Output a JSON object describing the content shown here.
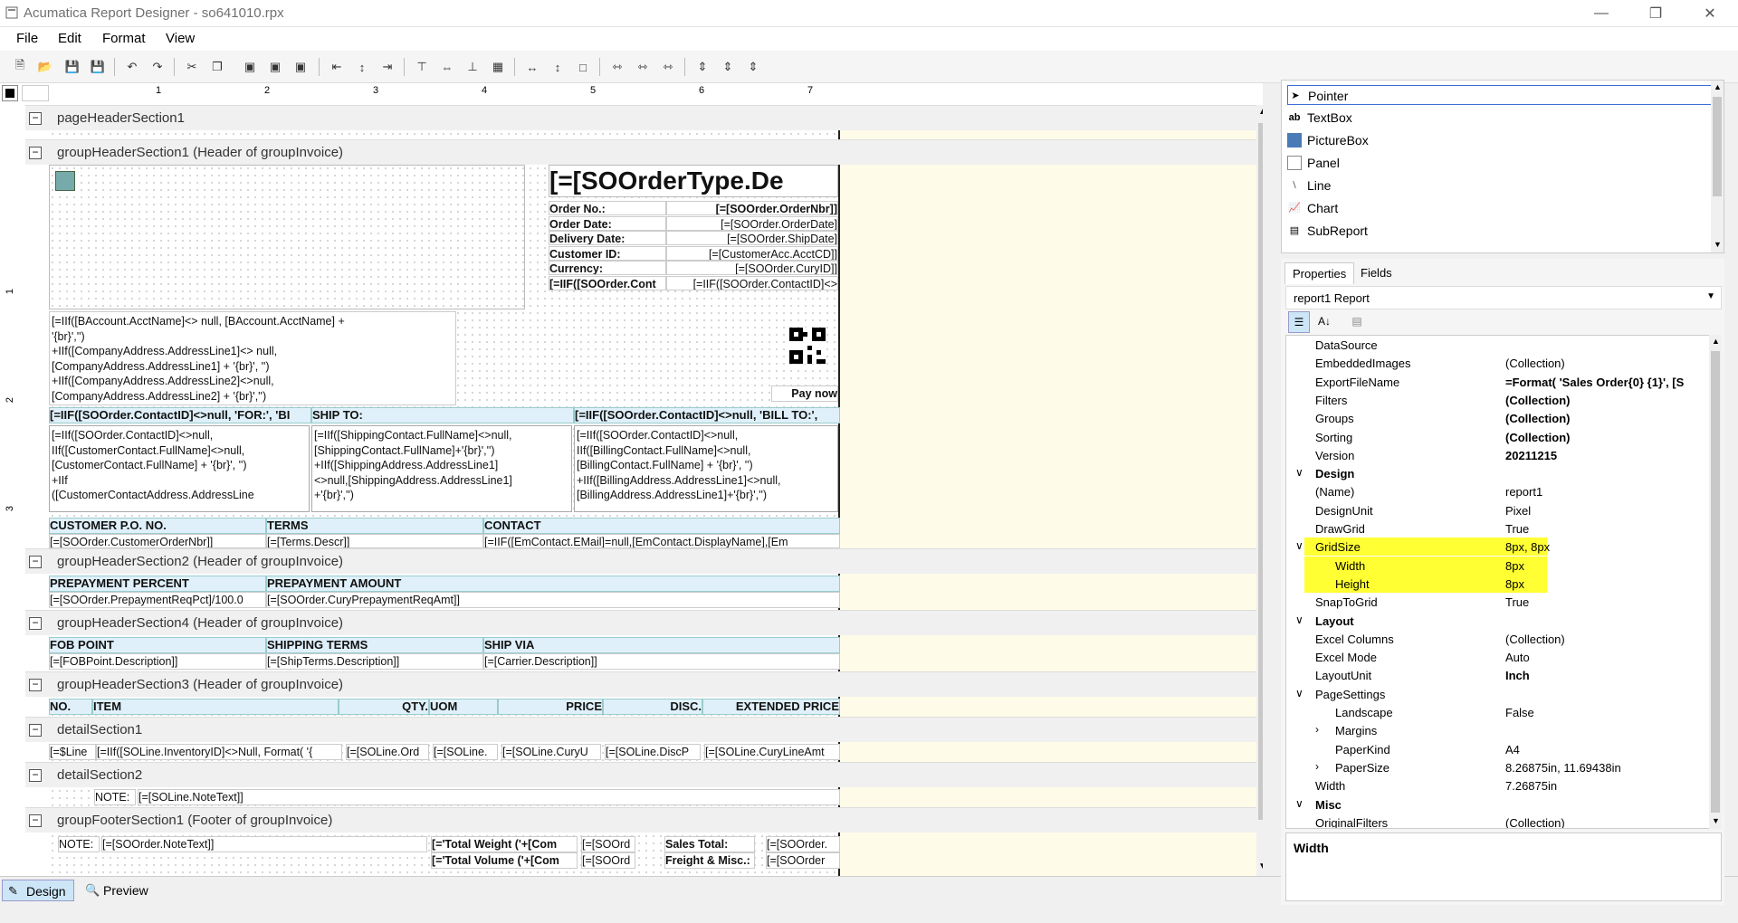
{
  "window": {
    "title": "Acumatica Report Designer - so641010.rpx"
  },
  "menu": [
    "File",
    "Edit",
    "Format",
    "View"
  ],
  "ruler": {
    "h": [
      "1",
      "2",
      "3",
      "4",
      "5",
      "6",
      "7"
    ],
    "v": [
      "1",
      "2",
      "3"
    ]
  },
  "sections": {
    "s1": "pageHeaderSection1",
    "s2": "groupHeaderSection1 (Header of groupInvoice)",
    "s3": "groupHeaderSection2 (Header of groupInvoice)",
    "s4": "groupHeaderSection4 (Header of groupInvoice)",
    "s5": "groupHeaderSection3 (Header of groupInvoice)",
    "s6": "detailSection1",
    "s7": "detailSection2",
    "s8": "groupFooterSection1 (Footer of groupInvoice)"
  },
  "header": {
    "title": "[=[SOOrderType.De",
    "fields": [
      [
        "Order No.:",
        "[=[SOOrder.OrderNbr]]"
      ],
      [
        "Order Date:",
        "[=[SOOrder.OrderDate]"
      ],
      [
        "Delivery Date:",
        "[=[SOOrder.ShipDate]"
      ],
      [
        "Customer ID:",
        "[=[CustomerAcc.AcctCD]]"
      ],
      [
        "Currency:",
        "[=[SOOrder.CuryID]]"
      ],
      [
        "[=IIF([SOOrder.Cont",
        "[=IIF([SOOrder.ContactID]<>"
      ]
    ],
    "company": [
      "[=IIf([BAccount.AcctName]<> null, [BAccount.AcctName] +",
      "'{br}','')",
      "+IIf([CompanyAddress.AddressLine1]<> null,",
      "[CompanyAddress.AddressLine1] + '{br}', '')",
      "+IIf([CompanyAddress.AddressLine2]<>null,",
      "[CompanyAddress.AddressLine2] + '{br}','')"
    ],
    "paynow": "Pay now",
    "cols": [
      "[=IIF([SOOrder.ContactID]<>null, 'FOR:', 'BI",
      "SHIP TO:",
      "[=IIF([SOOrder.ContactID]<>null, 'BILL TO:',"
    ],
    "col1": [
      "[=IIf([SOOrder.ContactID]<>null,",
      "IIf([CustomerContact.FullName]<>null,",
      "[CustomerContact.FullName] + '{br}', '')",
      "+IIf",
      "([CustomerContactAddress.AddressLine"
    ],
    "col2": [
      "[=IIf([ShippingContact.FullName]<>null,",
      "[ShippingContact.FullName]+'{br}','')",
      "+IIf([ShippingAddress.AddressLine1]",
      "<>null,[ShippingAddress.AddressLine1]",
      "+'{br}','')"
    ],
    "col3": [
      "[=IIf([SOOrder.ContactID]<>null,",
      "IIf([BillingContact.FullName]<>null,",
      "[BillingContact.FullName] + '{br}', '')",
      "+IIf([BillingAddress.AddressLine1]<>null,",
      "[BillingAddress.AddressLine1]+'{br}','')"
    ],
    "po": [
      "CUSTOMER P.O. NO.",
      "TERMS",
      "CONTACT"
    ],
    "poVals": [
      "[=[SOOrder.CustomerOrderNbr]]",
      "[=[Terms.Descr]]",
      "[=IIF([EmContact.EMail]=null,[EmContact.DisplayName],[Em"
    ]
  },
  "gh2": {
    "hdr": [
      "PREPAYMENT PERCENT",
      "PREPAYMENT AMOUNT"
    ],
    "vals": [
      "[=[SOOrder.PrepaymentReqPct]/100.0",
      "[=[SOOrder.CuryPrepaymentReqAmt]]"
    ]
  },
  "gh4": {
    "hdr": [
      "FOB POINT",
      "SHIPPING TERMS",
      "SHIP VIA"
    ],
    "vals": [
      "[=[FOBPoint.Description]]",
      "[=[ShipTerms.Description]]",
      "[=[Carrier.Description]]"
    ]
  },
  "gh3": {
    "hdr": [
      "NO.",
      "ITEM",
      "QTY.",
      "UOM",
      "PRICE",
      "DISC.",
      "EXTENDED PRICE"
    ]
  },
  "detail1": [
    "[=$Line",
    "[=IIf([SOLine.InventoryID]<>Null, Format( '{",
    "[=[SOLine.Ord",
    "[=[SOLine.",
    "[=[SOLine.CuryU",
    "[=[SOLine.DiscP",
    "[=[SOLine.CuryLineAmt"
  ],
  "detail2": {
    "note": "NOTE:",
    "val": "[=[SOLine.NoteText]]"
  },
  "footer": {
    "note": "NOTE:",
    "val": "[=[SOOrder.NoteText]]",
    "tw": "[='Total Weight ('+[Com",
    "tv": "[='Total Volume ('+[Com",
    "so1": "[=[SOOrd",
    "so2": "[=[SOOrd",
    "st": "Sales Total:",
    "fm": "Freight & Misc.:",
    "v1": "[=[SOOrder.",
    "v2": "[=[SOOrder"
  },
  "bottomTabs": [
    "Design",
    "Preview"
  ],
  "toolbox": [
    "Pointer",
    "TextBox",
    "PictureBox",
    "Panel",
    "Line",
    "Chart",
    "SubReport"
  ],
  "propTabs": [
    "Properties",
    "Fields"
  ],
  "objectSelector": "report1 Report",
  "props": [
    {
      "n": "DataSource",
      "v": ""
    },
    {
      "n": "EmbeddedImages",
      "v": "(Collection)"
    },
    {
      "n": "ExportFileName",
      "v": "=Format( 'Sales Order{0} {1}', [S",
      "b": true
    },
    {
      "n": "Filters",
      "v": "(Collection)",
      "b": true
    },
    {
      "n": "Groups",
      "v": "(Collection)",
      "b": true
    },
    {
      "n": "Sorting",
      "v": "(Collection)",
      "b": true
    },
    {
      "n": "Version",
      "v": "20211215",
      "b": true
    },
    {
      "n": "Design",
      "v": "",
      "cat": true
    },
    {
      "n": "(Name)",
      "v": "report1"
    },
    {
      "n": "DesignUnit",
      "v": "Pixel"
    },
    {
      "n": "DrawGrid",
      "v": "True"
    },
    {
      "n": "GridSize",
      "v": "8px, 8px",
      "hl": true,
      "exp": true
    },
    {
      "n": "Width",
      "v": "8px",
      "hl": true,
      "sub": true
    },
    {
      "n": "Height",
      "v": "8px",
      "hl": true,
      "sub": true
    },
    {
      "n": "SnapToGrid",
      "v": "True"
    },
    {
      "n": "Layout",
      "v": "",
      "cat": true
    },
    {
      "n": "Excel Columns",
      "v": "(Collection)"
    },
    {
      "n": "Excel Mode",
      "v": "Auto"
    },
    {
      "n": "LayoutUnit",
      "v": "Inch",
      "b": true
    },
    {
      "n": "PageSettings",
      "v": "",
      "exp": true
    },
    {
      "n": "Landscape",
      "v": "False",
      "sub": true
    },
    {
      "n": "Margins",
      "v": "",
      "sub": true,
      "col": true
    },
    {
      "n": "PaperKind",
      "v": "A4",
      "sub": true
    },
    {
      "n": "PaperSize",
      "v": "8.26875in, 11.69438in",
      "sub": true,
      "col": true
    },
    {
      "n": "Width",
      "v": "7.26875in"
    },
    {
      "n": "Misc",
      "v": "",
      "cat": true
    },
    {
      "n": "OriginalFilters",
      "v": "(Collection)"
    }
  ],
  "description": "Width"
}
